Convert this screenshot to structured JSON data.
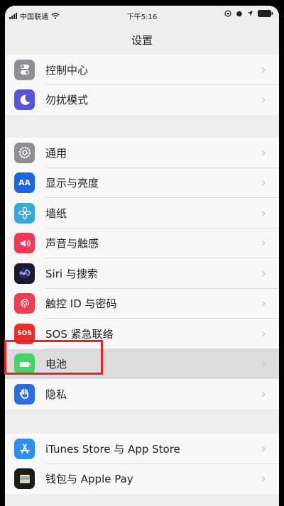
{
  "status": {
    "carrier": "中国联通",
    "time": "下午5:16"
  },
  "page": {
    "title": "设置"
  },
  "colors": {
    "control_center_icon": "#8e8e93",
    "dnd_icon": "#5856d6",
    "general_icon": "#8e8e93",
    "display_icon": "#1e66e0",
    "wallpaper_icon": "#37a8dc",
    "sounds_icon": "#ee3a57",
    "siri_icon": "#1a1a2e",
    "touchid_icon": "#ec3e52",
    "sos_icon": "#e3312e",
    "battery_icon": "#45d36a",
    "privacy_icon": "#2d6be0",
    "itunes_icon": "#2d8ef0",
    "wallet_icon": "#1c1c1c",
    "highlight": "#e5242b"
  },
  "groups": [
    {
      "items": [
        {
          "label": "控制中心",
          "icon": "toggles-icon"
        },
        {
          "label": "勿扰模式",
          "icon": "moon-icon"
        }
      ]
    },
    {
      "items": [
        {
          "label": "通用",
          "icon": "gear-icon"
        },
        {
          "label": "显示与亮度",
          "icon": "aa-text-icon"
        },
        {
          "label": "墙纸",
          "icon": "flower-icon"
        },
        {
          "label": "声音与触感",
          "icon": "speaker-icon"
        },
        {
          "label": "Siri 与搜索",
          "icon": "siri-icon"
        },
        {
          "label": "触控 ID 与密码",
          "icon": "fingerprint-icon"
        },
        {
          "label": "SOS 紧急联络",
          "icon": "sos-icon",
          "icon_text": "SOS"
        },
        {
          "label": "电池",
          "icon": "battery-icon",
          "selected": true
        },
        {
          "label": "隐私",
          "icon": "hand-icon"
        }
      ]
    },
    {
      "items": [
        {
          "label": "iTunes Store 与 App Store",
          "icon": "app-store-icon"
        },
        {
          "label": "钱包与 Apple Pay",
          "icon": "wallet-icon"
        }
      ]
    }
  ]
}
